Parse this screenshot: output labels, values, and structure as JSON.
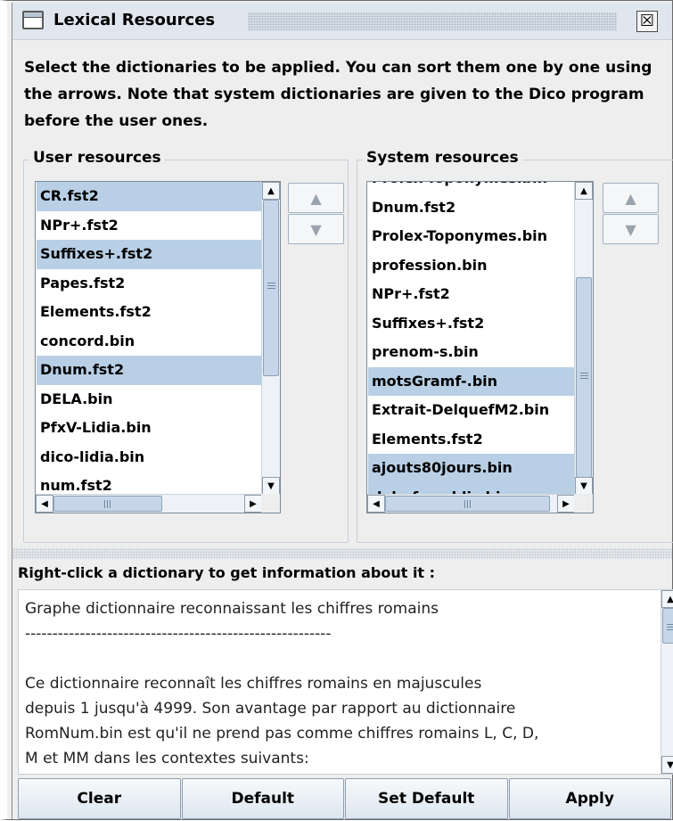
{
  "window": {
    "title": "Lexical Resources",
    "close_glyph": "☒"
  },
  "description": "Select the dictionaries to be applied. You can sort them one by one using the arrows. Note that system dictionaries are given to the Dico program before the user ones.",
  "user_resources": {
    "title": "User resources",
    "items": [
      {
        "label": "CR.fst2",
        "selected": true
      },
      {
        "label": "NPr+.fst2",
        "selected": false
      },
      {
        "label": "Suffixes+.fst2",
        "selected": true
      },
      {
        "label": "Papes.fst2",
        "selected": false
      },
      {
        "label": "Elements.fst2",
        "selected": false
      },
      {
        "label": "concord.bin",
        "selected": false
      },
      {
        "label": "Dnum.fst2",
        "selected": true
      },
      {
        "label": "DELA.bin",
        "selected": false
      },
      {
        "label": "PfxV-Lidia.bin",
        "selected": false
      },
      {
        "label": "dico-lidia.bin",
        "selected": false
      },
      {
        "label": "num.fst2",
        "selected": false
      }
    ],
    "up_glyph": "▲",
    "down_glyph": "▼"
  },
  "system_resources": {
    "title": "System resources",
    "items": [
      {
        "label": "Prolex-Toponymes.bin",
        "selected": false
      },
      {
        "label": "Dnum.fst2",
        "selected": false
      },
      {
        "label": "Prolex-Toponymes.bin",
        "selected": false
      },
      {
        "label": "profession.bin",
        "selected": false
      },
      {
        "label": "NPr+.fst2",
        "selected": false
      },
      {
        "label": "Suffixes+.fst2",
        "selected": false
      },
      {
        "label": "prenom-s.bin",
        "selected": false
      },
      {
        "label": "motsGramf-.bin",
        "selected": true
      },
      {
        "label": "Extrait-DelquefM2.bin",
        "selected": false
      },
      {
        "label": "Elements.fst2",
        "selected": false
      },
      {
        "label": "ajouts80jours.bin",
        "selected": true
      },
      {
        "label": "dela-fr-public.bin",
        "selected": true
      }
    ],
    "up_glyph": "▲",
    "down_glyph": "▼"
  },
  "info": {
    "label": "Right-click a dictionary to get information about it :",
    "lines": [
      "Graphe dictionnaire reconnaissant les chiffres romains",
      "--------------------------------------------------------",
      "",
      "Ce dictionnaire reconnaît les chiffres romains en majuscules",
      "depuis 1 jusqu'à 4999. Son avantage par rapport au dictionnaire",
      "RomNum.bin est qu'il ne prend pas comme chiffres romains L, C, D,",
      "M et MM dans les contextes suivants:"
    ]
  },
  "buttons": {
    "clear": "Clear",
    "default": "Default",
    "set_default": "Set Default",
    "apply": "Apply"
  }
}
